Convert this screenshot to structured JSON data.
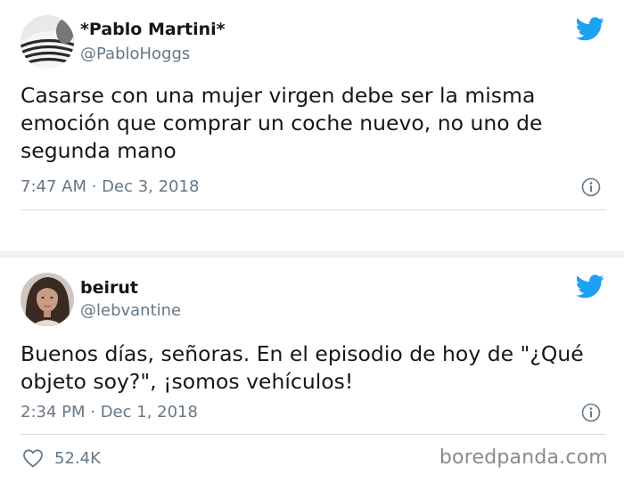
{
  "tweets": [
    {
      "name": "*Pablo Martini*",
      "handle": "@PabloHoggs",
      "text": "Casarse con una mujer virgen debe ser la misma emoción que comprar un coche nuevo, no uno de segunda mano",
      "timestamp": "7:47 AM · Dec 3, 2018",
      "avatar_icon": "avatar-striped-shirt",
      "icons": [
        "twitter-bird-icon",
        "info-icon"
      ]
    },
    {
      "name": "beirut",
      "handle": "@lebvantine",
      "text": "Buenos días, señoras. En el episodio de hoy de \"¿Qué objeto soy?\", ¡somos vehículos!",
      "timestamp": "2:34 PM · Dec 1, 2018",
      "likes": "52.4K",
      "avatar_icon": "avatar-woman-portrait",
      "icons": [
        "twitter-bird-icon",
        "info-icon",
        "heart-icon"
      ]
    }
  ],
  "watermark": "boredpanda.com",
  "colors": {
    "twitter_blue": "#1da1f2",
    "text": "#14171a",
    "muted": "#657786",
    "divider": "#d6dde2"
  }
}
